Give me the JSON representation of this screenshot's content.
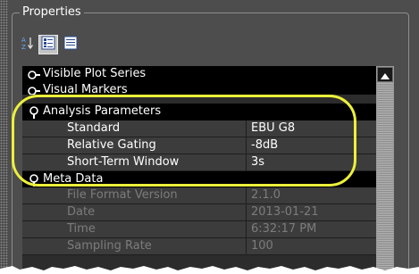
{
  "panel": {
    "title": "Properties"
  },
  "toolbar": {
    "buttons": [
      {
        "icon": "sort-alpha-icon"
      },
      {
        "icon": "categorized-view-icon"
      },
      {
        "icon": "list-view-icon"
      }
    ]
  },
  "table": {
    "sections": [
      {
        "label": "Visible Plot Series",
        "expanded": false
      },
      {
        "label": "Visual Markers",
        "expanded": false
      },
      {
        "label": "Analysis Parameters",
        "expanded": true,
        "rows": [
          {
            "name": "Standard",
            "value": "EBU G8"
          },
          {
            "name": "Relative Gating",
            "value": "-8dB"
          },
          {
            "name": "Short-Term Window",
            "value": "3s"
          }
        ]
      },
      {
        "label": "Meta Data",
        "expanded": true,
        "rows": [
          {
            "name": "File Format Version",
            "value": "2.1.0"
          },
          {
            "name": "Date",
            "value": "2013-01-21"
          },
          {
            "name": "Time",
            "value": "6:32:17 PM"
          },
          {
            "name": "Sampling Rate",
            "value": "100"
          }
        ]
      }
    ]
  },
  "colors": {
    "callout": "#ecf03a",
    "panel_bg": "#4d4d4d",
    "header_row": "#000000",
    "property_row": "#3c3c3c"
  }
}
